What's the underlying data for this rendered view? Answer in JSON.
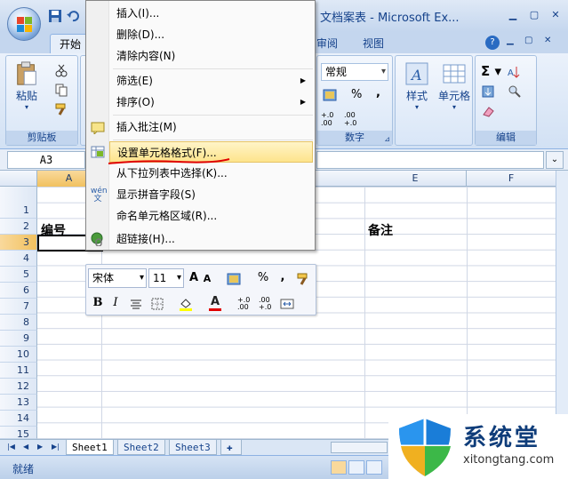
{
  "window": {
    "title": "文档案表 - Microsoft Ex..."
  },
  "tabs": [
    {
      "label": "开始",
      "active": true
    },
    {
      "label": "审阅"
    },
    {
      "label": "视图"
    }
  ],
  "ribbon": {
    "clipboard": {
      "paste_label": "粘贴",
      "group_label": "剪贴板"
    },
    "number": {
      "format_value": "常规",
      "percent": "%",
      "comma": ",",
      "inc_decimal": "+.0 .00",
      "dec_decimal": ".00 +.0",
      "group_label": "数字"
    },
    "styles": {
      "label": "样式"
    },
    "cells": {
      "label": "单元格"
    },
    "edit": {
      "group_label": "编辑"
    }
  },
  "formula_bar": {
    "name_box": "A3",
    "formula": ""
  },
  "grid": {
    "columns": [
      "A",
      "E",
      "F"
    ],
    "rows": [
      "1",
      "2",
      "3",
      "4",
      "5",
      "6",
      "7",
      "8",
      "9",
      "10",
      "11",
      "12",
      "13",
      "14",
      "15"
    ],
    "cells": {
      "A2": "编号",
      "E2": "备注"
    },
    "active_cell": "A3"
  },
  "context_menu": {
    "items": [
      {
        "label": "插入(I)...",
        "icon": ""
      },
      {
        "label": "删除(D)...",
        "icon": ""
      },
      {
        "label": "清除内容(N)",
        "icon": ""
      },
      {
        "label": "筛选(E)",
        "submenu": true
      },
      {
        "label": "排序(O)",
        "submenu": true
      },
      {
        "label": "插入批注(M)",
        "icon": "comment-icon"
      },
      {
        "label": "设置单元格格式(F)...",
        "icon": "format-cells-icon",
        "highlighted": true
      },
      {
        "label": "从下拉列表中选择(K)...",
        "icon": ""
      },
      {
        "label": "显示拼音字段(S)",
        "icon": "phonetic-icon"
      },
      {
        "label": "命名单元格区域(R)...",
        "icon": ""
      },
      {
        "label": "超链接(H)...",
        "icon": "hyperlink-icon"
      }
    ],
    "phonetic_glyph": "wén 文"
  },
  "mini_toolbar": {
    "font": "宋体",
    "size": "11",
    "grow": "A",
    "shrink": "A",
    "percent": "%",
    "comma": ",",
    "bold": "B",
    "italic": "I",
    "font_color_letter": "A",
    "inc_decimal": "+.0 .00",
    "dec_decimal": ".00 +.0"
  },
  "sheets": [
    {
      "label": "Sheet1",
      "active": true
    },
    {
      "label": "Sheet2"
    },
    {
      "label": "Sheet3"
    }
  ],
  "status": {
    "ready": "就绪"
  },
  "watermark": {
    "brand": "系统堂",
    "url": "xitongtang.com"
  },
  "colors": {
    "ribbon_blue": "#15428b",
    "highlight": "#fde48c",
    "underline": "#e00000"
  }
}
